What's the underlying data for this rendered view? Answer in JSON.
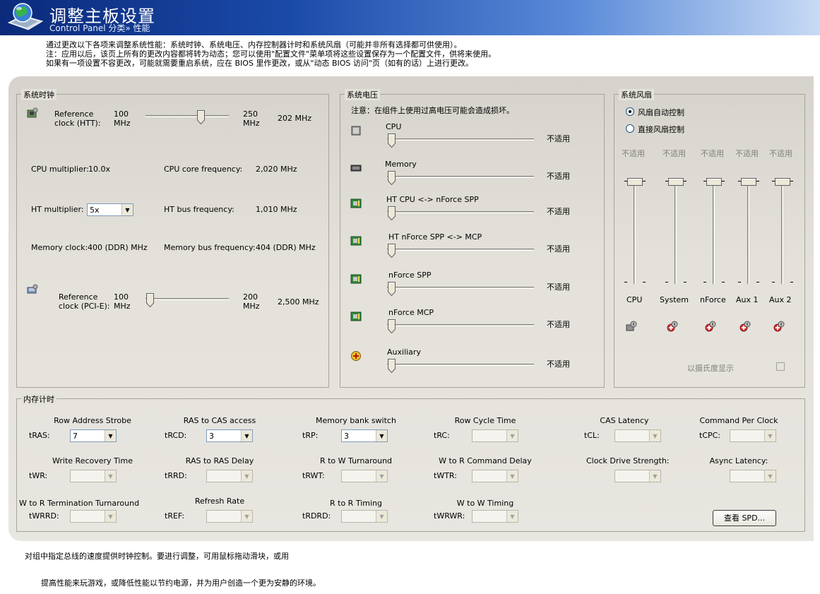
{
  "header": {
    "title": "调整主板设置",
    "breadcrumb": "Control Panel 分类» 性能"
  },
  "intro": {
    "line1": "通过更改以下各项来调整系统性能：系统时钟、系统电压、内存控制器计时和系统风扇（可能并非所有选择都可供使用）。",
    "line2": "注：应用以后，该页上所有的更改内容都将转为动态；您可以使用\"配置文件\"菜单项将这些设置保存为一个配置文件，供将来使用。",
    "line3": "如果有一项设置不容更改，可能就需要重启系统，应在 BIOS 里作更改，或从\"动态 BIOS 访问\"页（如有的话）上进行更改。"
  },
  "clock": {
    "title": "系统时钟",
    "htt_label": "Reference clock (HTT):",
    "htt_label_1": "Reference",
    "htt_label_2": "clock (HTT):",
    "htt_min_1": "100",
    "htt_min_2": "MHz",
    "htt_max_1": "250",
    "htt_max_2": "MHz",
    "htt_value": "202 MHz",
    "cpu_multiplier_label": "CPU multiplier:",
    "cpu_multiplier_value": "10.0x",
    "cpu_core_freq_label": "CPU core frequency:",
    "cpu_core_freq_value": "2,020 MHz",
    "ht_multiplier_label": "HT multiplier:",
    "ht_multiplier_value": "5x",
    "ht_bus_freq_label": "HT bus frequency:",
    "ht_bus_freq_value": "1,010 MHz",
    "memory_clock_label": "Memory clock:",
    "memory_clock_value": "400 (DDR) MHz",
    "memory_bus_freq_label": "Memory bus frequency:",
    "memory_bus_freq_value": "404 (DDR) MHz",
    "pcie_label_1": "Reference",
    "pcie_label_2": "clock (PCI-E):",
    "pcie_min_1": "100",
    "pcie_min_2": "MHz",
    "pcie_max_1": "200",
    "pcie_max_2": "MHz",
    "pcie_value": "2,500 MHz"
  },
  "voltage": {
    "title": "系统电压",
    "warning": "注意：在组件上使用过高电压可能会造成损坏。",
    "items": [
      {
        "label": "CPU",
        "value": "不适用"
      },
      {
        "label": "Memory",
        "value": "不适用"
      },
      {
        "label": "HT CPU <-> nForce SPP",
        "value": "不适用"
      },
      {
        "label": "HT nForce SPP <-> MCP",
        "value": "不适用"
      },
      {
        "label": "nForce SPP",
        "value": "不适用"
      },
      {
        "label": "nForce MCP",
        "value": "不适用"
      },
      {
        "label": "Auxiliary",
        "value": "不适用"
      }
    ]
  },
  "fan": {
    "title": "系统风扇",
    "auto_label": "风扇自动控制",
    "manual_label": "直接风扇控制",
    "fans": [
      {
        "label": "CPU",
        "value": "不适用"
      },
      {
        "label": "System",
        "value": "不适用"
      },
      {
        "label": "nForce",
        "value": "不适用"
      },
      {
        "label": "Aux 1",
        "value": "不适用"
      },
      {
        "label": "Aux 2",
        "value": "不适用"
      }
    ],
    "celsius_label": "以摄氏度显示"
  },
  "memory": {
    "title": "内存计时",
    "row1": [
      {
        "title": "Row Address Strobe",
        "abbr": "tRAS:",
        "value": "7",
        "enabled": true
      },
      {
        "title": "RAS to CAS access",
        "abbr": "tRCD:",
        "value": "3",
        "enabled": true
      },
      {
        "title": "Memory bank switch",
        "abbr": "tRP:",
        "value": "3",
        "enabled": true
      },
      {
        "title": "Row Cycle Time",
        "abbr": "tRC:",
        "value": "",
        "enabled": false
      },
      {
        "title": "CAS Latency",
        "abbr": "tCL:",
        "value": "",
        "enabled": false
      },
      {
        "title": "Command Per Clock",
        "abbr": "tCPC:",
        "value": "",
        "enabled": false
      }
    ],
    "row2": [
      {
        "title": "Write Recovery Time",
        "abbr": "tWR:",
        "value": "",
        "enabled": false
      },
      {
        "title": "RAS to RAS Delay",
        "abbr": "tRRD:",
        "value": "",
        "enabled": false
      },
      {
        "title": "R to W Turnaround",
        "abbr": "tRWT:",
        "value": "",
        "enabled": false
      },
      {
        "title": "W to R Command Delay",
        "abbr": "tWTR:",
        "value": "",
        "enabled": false
      },
      {
        "title": "Clock Drive Strength:",
        "abbr": "",
        "value": "",
        "enabled": false
      },
      {
        "title": "Async Latency:",
        "abbr": "",
        "value": "",
        "enabled": false
      }
    ],
    "row3": [
      {
        "title": "W to R Termination Turnaround",
        "abbr": "tWRRD:",
        "value": "",
        "enabled": false
      },
      {
        "title": "Refresh Rate",
        "abbr": "tREF:",
        "value": "",
        "enabled": false
      },
      {
        "title": "R to R Timing",
        "abbr": "tRDRD:",
        "value": "",
        "enabled": false
      },
      {
        "title": "W to W Timing",
        "abbr": "tWRWR:",
        "value": "",
        "enabled": false
      }
    ],
    "spd_button": "查看 SPD..."
  },
  "footer": {
    "line1": "对组中指定总线的速度提供时钟控制。要进行调整，可用鼠标拖动滑块，或用",
    "line2": "提高性能来玩游戏，或降低性能以节约电源，并为用户创造一个更为安静的环境。"
  },
  "icons": {
    "header": "control-panel-globe-icon",
    "clock": "motherboard-chip-icon",
    "pcie": "pci-card-icon",
    "cpu_chip": "cpu-chip-icon",
    "memory_chip": "memory-chip-icon",
    "board": "green-board-icon",
    "auxiliary": "plus-circle-icon",
    "fan": "fan-icon"
  },
  "colors": {
    "header_dark": "#0b2a7a",
    "header_light": "#c8daf5",
    "panel": "#e4e1da"
  }
}
